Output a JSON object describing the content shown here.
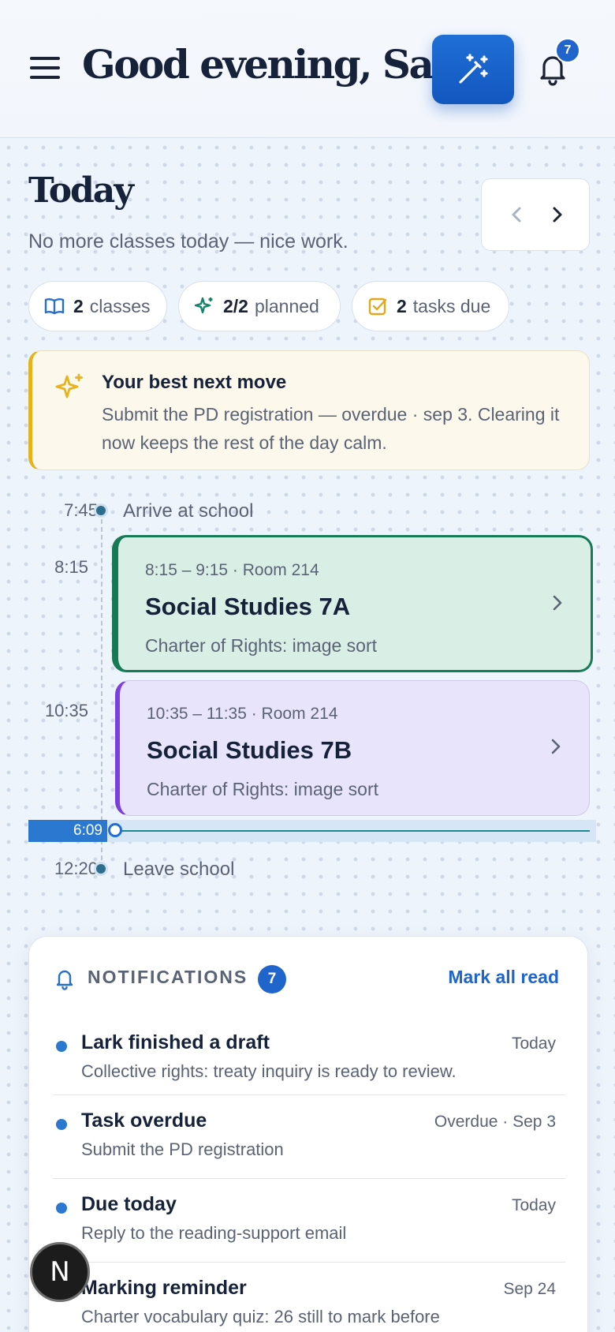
{
  "header": {
    "greeting": "Good evening, Sam",
    "notification_badge": "7",
    "menu_icon": "hamburger-menu-icon",
    "magic_icon": "magic-wand-icon",
    "bell_icon": "bell-icon"
  },
  "today": {
    "title": "Today",
    "subtitle": "No more classes today — nice work."
  },
  "chips": [
    {
      "count": "2",
      "label": "classes",
      "icon": "book-icon"
    },
    {
      "count": "2/2",
      "label": "planned",
      "icon": "sparkle-icon"
    },
    {
      "count": "2",
      "label": "tasks due",
      "icon": "checkbox-icon"
    }
  ],
  "best_move": {
    "title": "Your best next move",
    "body": "Submit the PD registration — overdue · sep 3. Clearing it now keeps the rest of the day calm."
  },
  "timeline": {
    "arrive_time": "7:45",
    "arrive_label": "Arrive at school",
    "leave_time": "12:20",
    "leave_label": "Leave school",
    "now_time": "6:09",
    "classes": [
      {
        "start": "8:15",
        "meta": "8:15 – 9:15 · Room 214",
        "name": "Social Studies 7A",
        "topic": "Charter of Rights: image sort"
      },
      {
        "start": "10:35",
        "meta": "10:35 – 11:35 · Room 214",
        "name": "Social Studies 7B",
        "topic": "Charter of Rights: image sort"
      }
    ]
  },
  "notifications": {
    "heading": "NOTIFICATIONS",
    "count": "7",
    "mark_all": "Mark all read",
    "items": [
      {
        "title": "Lark finished a draft",
        "when": "Today",
        "desc": "Collective rights: treaty inquiry is ready to review."
      },
      {
        "title": "Task overdue",
        "when": "Overdue · Sep 3",
        "desc": "Submit the PD registration"
      },
      {
        "title": "Due today",
        "when": "Today",
        "desc": "Reply to the reading-support email"
      },
      {
        "title": "Marking reminder",
        "when": "Sep 24",
        "desc": "Charter vocabulary quiz: 26 still to mark before"
      }
    ]
  },
  "fab": {
    "label": "N"
  },
  "colors": {
    "accent": "#1f65cc",
    "card_7a_bg": "#d9efe5",
    "card_7a_border": "#177a57",
    "card_7b_bg": "#e8e4fb",
    "card_7b_border": "#7c3fdc",
    "best_move_bar": "#e7b21c"
  }
}
